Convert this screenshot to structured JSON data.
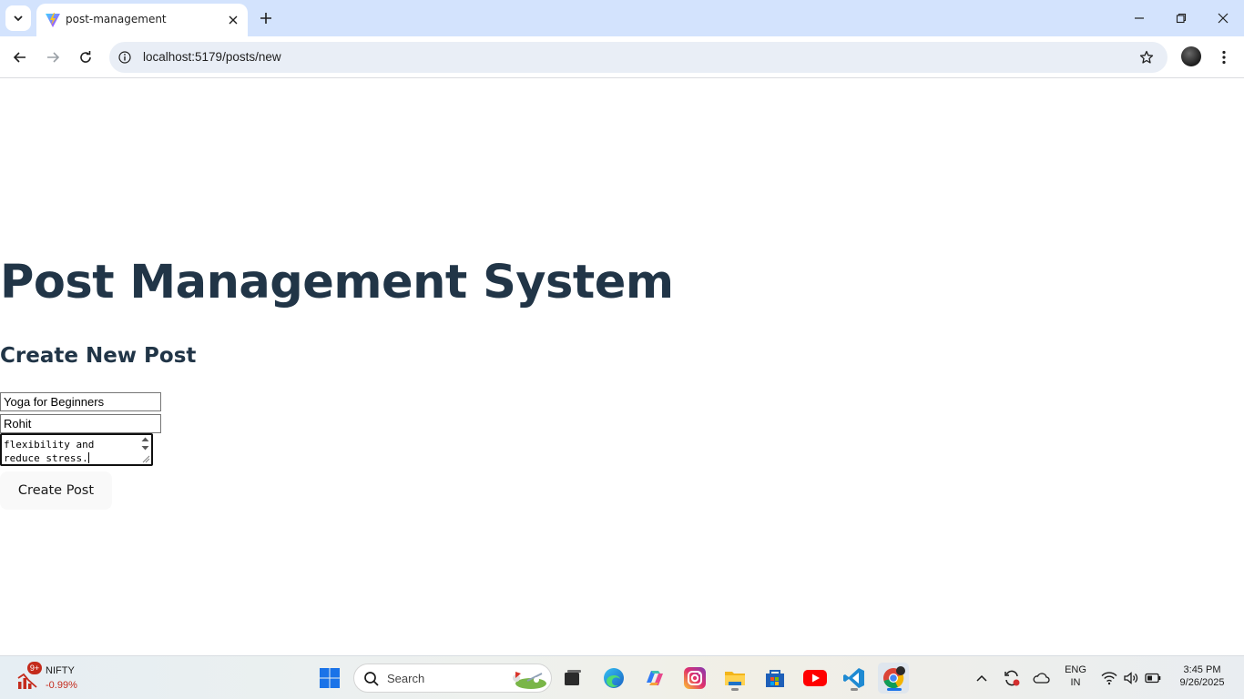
{
  "browser": {
    "tab_title": "post-management",
    "url": "localhost:5179/posts/new"
  },
  "page": {
    "heading": "Post Management System",
    "subheading": "Create New Post",
    "form": {
      "title_value": "Yoga for Beginners",
      "author_value": "Rohit",
      "content_line_1": "flexibility and",
      "content_line_2": "reduce stress.",
      "submit_label": "Create Post"
    }
  },
  "taskbar": {
    "widget": {
      "badge": "9+",
      "label": "NIFTY",
      "change": "-0.99%"
    },
    "search_placeholder": "Search",
    "tray": {
      "language_line1": "ENG",
      "language_line2": "IN",
      "time": "3:45 PM",
      "date": "9/26/2025"
    }
  },
  "colors": {
    "heading": "#213547",
    "tabstrip": "#d3e3fd",
    "omnibox": "#e9eef6",
    "button_bg": "#f9f9f9",
    "negative": "#c42b1c"
  }
}
